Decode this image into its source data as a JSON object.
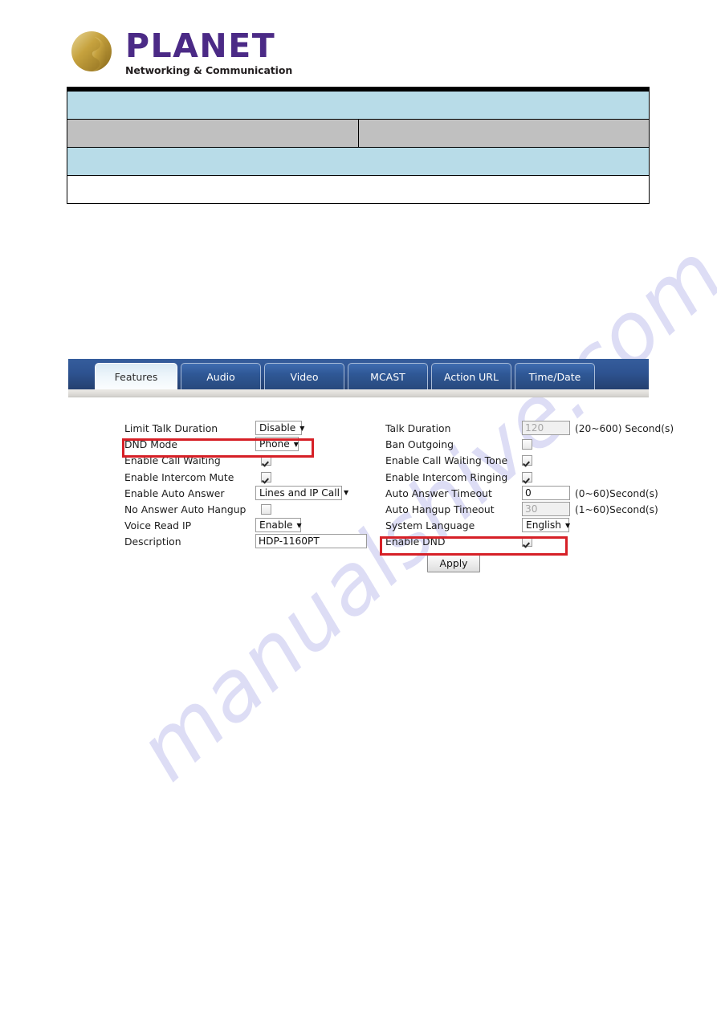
{
  "brand": {
    "name": "PLANET",
    "tagline": "Networking & Communication",
    "logo_icon": "planet-globe-icon",
    "word_color": "#4b2a86"
  },
  "watermark": {
    "text": "manualshive.com",
    "color": "#c9c9ef"
  },
  "note_table": {
    "rows": [
      {
        "style": "blue",
        "cells": [
          ""
        ]
      },
      {
        "style": "gray",
        "cells": [
          "",
          ""
        ]
      },
      {
        "style": "blue",
        "cells": [
          ""
        ]
      },
      {
        "style": "white",
        "cells": [
          ""
        ]
      }
    ]
  },
  "web_ui": {
    "tabs": [
      {
        "label": "Features",
        "active": true
      },
      {
        "label": "Audio",
        "active": false
      },
      {
        "label": "Video",
        "active": false
      },
      {
        "label": "MCAST",
        "active": false
      },
      {
        "label": "Action URL",
        "active": false
      },
      {
        "label": "Time/Date",
        "active": false
      }
    ],
    "left_column": [
      {
        "label": "Limit Talk Duration",
        "type": "select",
        "value": "Disable"
      },
      {
        "label": "DND Mode",
        "type": "select",
        "value": "Phone"
      },
      {
        "label": "Enable Call Waiting",
        "type": "checkbox",
        "checked": true
      },
      {
        "label": "Enable Intercom Mute",
        "type": "checkbox",
        "checked": true
      },
      {
        "label": "Enable Auto Answer",
        "type": "select",
        "value": "Lines and IP Call"
      },
      {
        "label": "No Answer Auto Hangup",
        "type": "checkbox",
        "checked": false
      },
      {
        "label": "Voice Read IP",
        "type": "select",
        "value": "Enable"
      },
      {
        "label": "Description",
        "type": "text",
        "value": "HDP-1160PT"
      }
    ],
    "right_column": [
      {
        "label": "Talk Duration",
        "type": "text",
        "value": "120",
        "disabled": true,
        "unit": "(20~600) Second(s)"
      },
      {
        "label": "Ban Outgoing",
        "type": "checkbox",
        "checked": false
      },
      {
        "label": "Enable Call Waiting Tone",
        "type": "checkbox",
        "checked": true
      },
      {
        "label": "Enable Intercom Ringing",
        "type": "checkbox",
        "checked": true
      },
      {
        "label": "Auto Answer Timeout",
        "type": "text",
        "value": "0",
        "disabled": false,
        "unit": "(0~60)Second(s)"
      },
      {
        "label": "Auto Hangup Timeout",
        "type": "text",
        "value": "30",
        "disabled": true,
        "unit": "(1~60)Second(s)"
      },
      {
        "label": "System Language",
        "type": "select",
        "value": "English"
      },
      {
        "label": "Enable DND",
        "type": "checkbox",
        "checked": true
      }
    ],
    "apply_label": "Apply",
    "highlight_color": "#d62027",
    "highlighted_fields": [
      "DND Mode",
      "Enable DND"
    ]
  }
}
